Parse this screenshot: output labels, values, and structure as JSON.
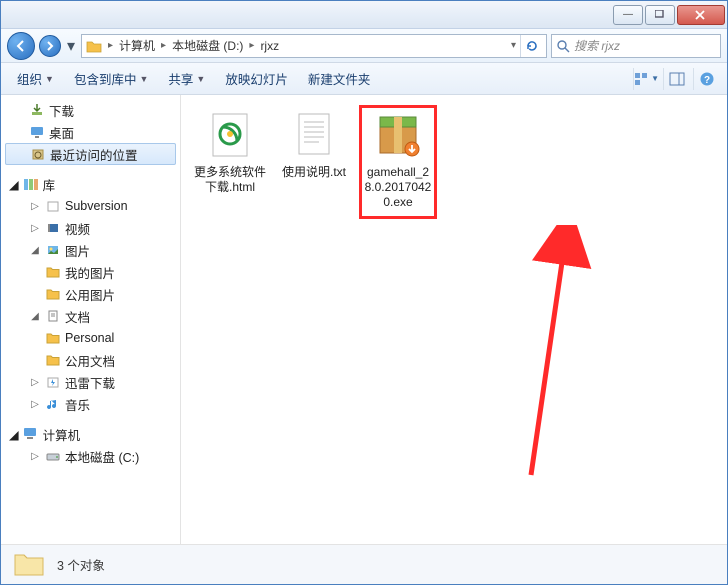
{
  "titlebar": {
    "min": "—",
    "max": "□",
    "close": "X"
  },
  "nav": {
    "computer": "计算机",
    "drive": "本地磁盘 (D:)",
    "folder": "rjxz"
  },
  "search": {
    "placeholder": "搜索 rjxz"
  },
  "toolbar": {
    "organize": "组织",
    "include": "包含到库中",
    "share": "共享",
    "slideshow": "放映幻灯片",
    "newfolder": "新建文件夹"
  },
  "tree": {
    "downloads": "下载",
    "desktop": "桌面",
    "recent": "最近访问的位置",
    "libraries": "库",
    "subversion": "Subversion",
    "videos": "视频",
    "pictures": "图片",
    "my_pictures": "我的图片",
    "public_pictures": "公用图片",
    "documents": "文档",
    "personal": "Personal",
    "public_docs": "公用文档",
    "thunder": "迅雷下载",
    "music": "音乐",
    "computer": "计算机",
    "drive_c": "本地磁盘 (C:)"
  },
  "files": [
    {
      "name": "更多系统软件下载.html"
    },
    {
      "name": "使用说明.txt"
    },
    {
      "name": "gamehall_28.0.20170420.exe"
    }
  ],
  "status": {
    "count": "3 个对象"
  }
}
